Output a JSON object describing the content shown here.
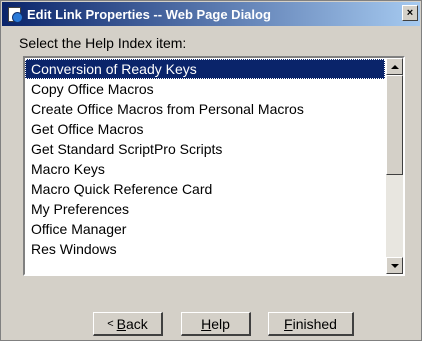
{
  "window": {
    "title": "Edit Link Properties -- Web Page Dialog",
    "close_label": "×"
  },
  "prompt": "Select the Help Index item:",
  "list": {
    "items": [
      "Conversion of Ready Keys",
      "Copy Office Macros",
      "Create Office Macros from Personal Macros",
      "Get Office Macros",
      "Get Standard ScriptPro Scripts",
      "Macro Keys",
      "Macro Quick Reference Card",
      "My Preferences",
      "Office Manager",
      "Res Windows"
    ],
    "selected": "Conversion of Ready Keys"
  },
  "buttons": {
    "back_arrow": "<",
    "back": "Back",
    "help": "Help",
    "finished": "Finished"
  },
  "colors": {
    "selection": "#0a246a",
    "titlebar_start": "#0a246a",
    "titlebar_end": "#a6caf0",
    "face": "#d4d0c8"
  }
}
